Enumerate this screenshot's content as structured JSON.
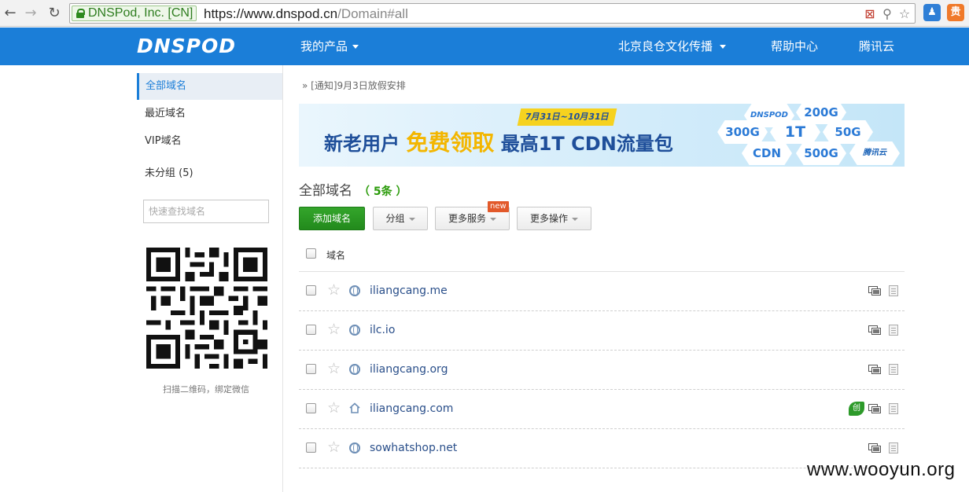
{
  "browser": {
    "back": "←",
    "forward": "→",
    "reload": "↻",
    "ev_cert": "DNSPod, Inc. [CN]",
    "url_host": "https://www.dnspod.cn",
    "url_path": "/Domain#all",
    "addr_icons": [
      "block-icon",
      "pin-icon",
      "star-icon"
    ],
    "ext1_glyph": "♟",
    "ext2_glyph": "贵",
    "ext1_color": "#2f7fd6",
    "ext2_color": "#f07a2a"
  },
  "header": {
    "logo": "DNSPOD",
    "my_products": "我的产品",
    "account": "北京良仓文化传播",
    "help": "帮助中心",
    "tencent": "腾讯云",
    "bg_color": "#1b7ed8"
  },
  "sidebar": {
    "items": [
      {
        "label": "全部域名",
        "active": true
      },
      {
        "label": "最近域名",
        "active": false
      },
      {
        "label": "VIP域名",
        "active": false
      },
      {
        "label": "未分组 (5)",
        "active": false
      }
    ],
    "search_placeholder": "快速查找域名",
    "qr_caption": "扫描二维码，绑定微信"
  },
  "notice": "» [通知]9月3日放假安排",
  "banner": {
    "prefix": "新老用户",
    "highlight": "免费领取",
    "suffix": "最高1T CDN流量包",
    "date_tag": "7月31日~10月31日",
    "hexes": {
      "brand": "DNSPOD",
      "h200": "200G",
      "h300": "300G",
      "h1t": "1T",
      "h50": "50G",
      "cdn": "CDN",
      "h500": "500G",
      "tencent": "腾讯云"
    }
  },
  "section": {
    "title": "全部域名",
    "count": "（ 5条 ）"
  },
  "toolbar": {
    "add": "添加域名",
    "group": "分组",
    "more_services": "更多服务",
    "more_ops": "更多操作",
    "new_badge": "new"
  },
  "table": {
    "column": "域名",
    "rows": [
      {
        "domain": "iliangcang.me",
        "icon": "globe-icon",
        "leaf": false
      },
      {
        "domain": "ilc.io",
        "icon": "globe-icon",
        "leaf": false
      },
      {
        "domain": "iliangcang.org",
        "icon": "globe-icon",
        "leaf": false
      },
      {
        "domain": "iliangcang.com",
        "icon": "house-icon",
        "leaf": true,
        "leaf_text": "创"
      },
      {
        "domain": "sowhatshop.net",
        "icon": "globe-icon",
        "leaf": false
      }
    ]
  },
  "watermark": "www.wooyun.org"
}
